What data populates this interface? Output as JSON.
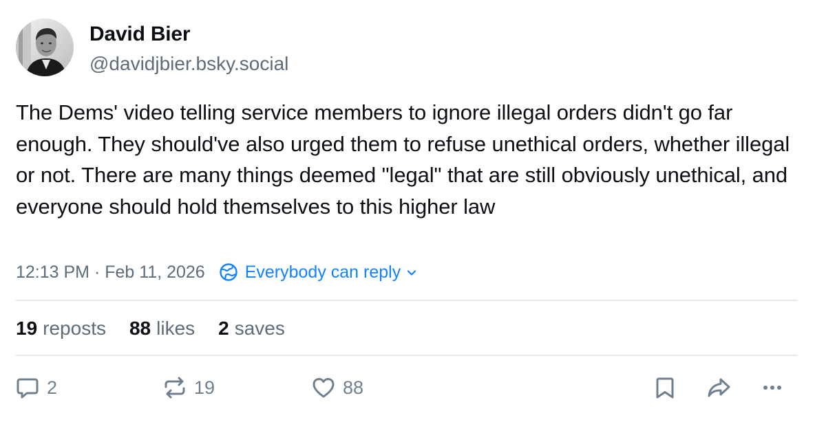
{
  "author": {
    "display_name": "David Bier",
    "handle": "@davidjbier.bsky.social"
  },
  "post": {
    "text": "The Dems' video telling service members to ignore illegal orders didn't go far enough. They should've also urged them to refuse unethical orders, whether illegal or not. There are many things deemed \"legal\" that are still obviously unethical, and everyone should hold themselves to this higher law"
  },
  "meta": {
    "timestamp": "12:13 PM · Feb 11, 2026",
    "reply_setting": "Everybody can reply"
  },
  "stats": {
    "reposts_count": "19",
    "reposts_label": "reposts",
    "likes_count": "88",
    "likes_label": "likes",
    "saves_count": "2",
    "saves_label": "saves"
  },
  "actions": {
    "reply_count": "2",
    "repost_count": "19",
    "like_count": "88"
  },
  "icons": {
    "reply": "speech-bubble-icon",
    "repost": "repost-arrows-icon",
    "like": "heart-outline-icon",
    "save": "bookmark-icon",
    "share": "share-arrow-icon",
    "more": "ellipsis-icon",
    "reply_setting": "globe-icon",
    "dropdown": "chevron-down-icon"
  },
  "colors": {
    "text": "#0b0f14",
    "muted": "#5d6c7b",
    "accent": "#1083fe",
    "divider": "#e3e8ed",
    "icon": "#6f7f8f"
  }
}
